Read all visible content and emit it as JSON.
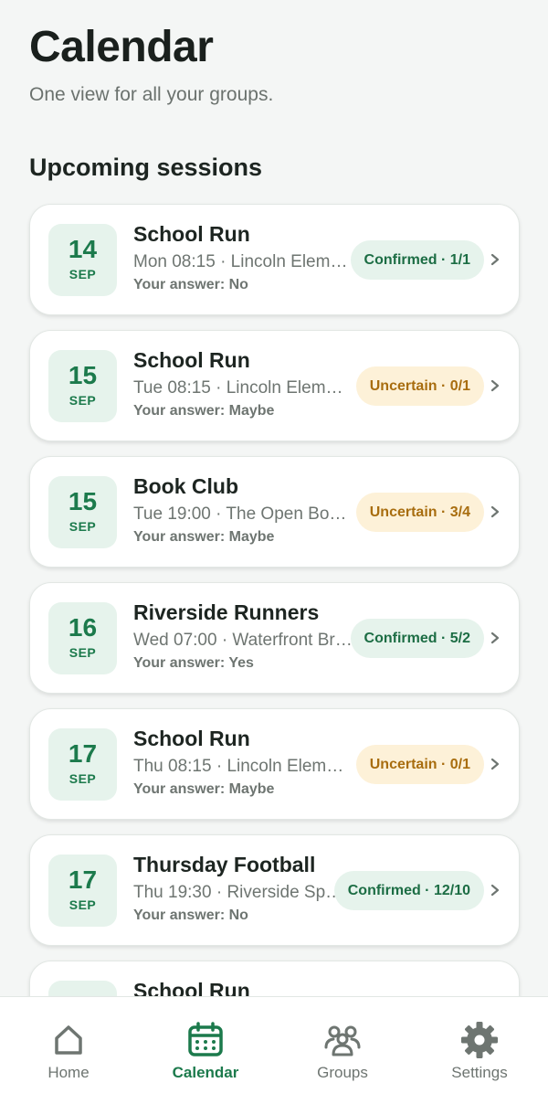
{
  "header": {
    "title": "Calendar",
    "subtitle": "One view for all your groups."
  },
  "section_title": "Upcoming sessions",
  "sessions": [
    {
      "day": "14",
      "month": "SEP",
      "title": "School Run",
      "meta": "Mon 08:15 · Lincoln Eleme…",
      "answer": "Your answer: No",
      "status": "Confirmed · 1/1",
      "status_type": "confirmed"
    },
    {
      "day": "15",
      "month": "SEP",
      "title": "School Run",
      "meta": "Tue 08:15 · Lincoln Elemen…",
      "answer": "Your answer: Maybe",
      "status": "Uncertain · 0/1",
      "status_type": "uncertain"
    },
    {
      "day": "15",
      "month": "SEP",
      "title": "Book Club",
      "meta": "Tue 19:00 · The Open Book…",
      "answer": "Your answer: Maybe",
      "status": "Uncertain · 3/4",
      "status_type": "uncertain"
    },
    {
      "day": "16",
      "month": "SEP",
      "title": "Riverside Runners",
      "meta": "Wed 07:00 · Waterfront Bri…",
      "answer": "Your answer: Yes",
      "status": "Confirmed · 5/2",
      "status_type": "confirmed"
    },
    {
      "day": "17",
      "month": "SEP",
      "title": "School Run",
      "meta": "Thu 08:15 · Lincoln Elemen…",
      "answer": "Your answer: Maybe",
      "status": "Uncertain · 0/1",
      "status_type": "uncertain"
    },
    {
      "day": "17",
      "month": "SEP",
      "title": "Thursday Football",
      "meta": "Thu 19:30 · Riverside Sp…",
      "answer": "Your answer: No",
      "status": "Confirmed · 12/10",
      "status_type": "confirmed"
    },
    {
      "day": "",
      "month": "",
      "title": "School Run",
      "meta": "",
      "answer": "",
      "status": "",
      "status_type": "none"
    }
  ],
  "tabs": [
    {
      "label": "Home",
      "icon": "home-icon",
      "active": false
    },
    {
      "label": "Calendar",
      "icon": "calendar-icon",
      "active": true
    },
    {
      "label": "Groups",
      "icon": "groups-icon",
      "active": false
    },
    {
      "label": "Settings",
      "icon": "gear-icon",
      "active": false
    }
  ],
  "colors": {
    "accent": "#1c7a4c",
    "confirmed_bg": "#e6f3ec",
    "uncertain_bg": "#fdf1d8",
    "uncertain_text": "#a86d0f",
    "background": "#f4f6f5"
  }
}
